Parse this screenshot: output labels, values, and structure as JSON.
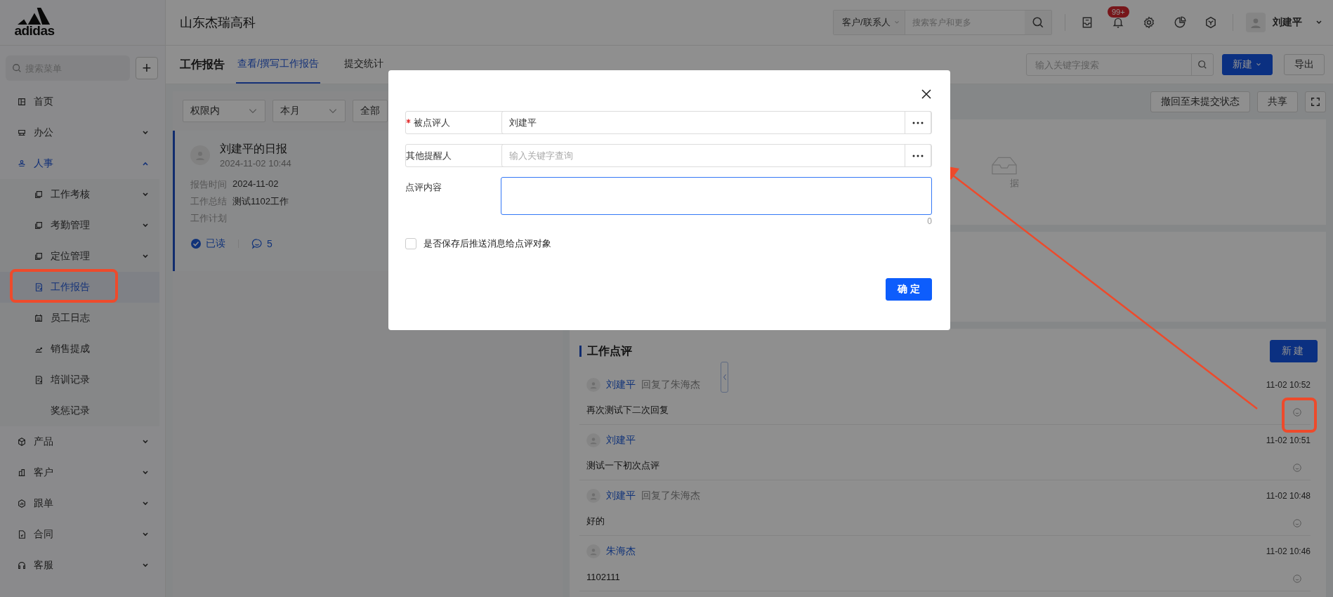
{
  "logo": {
    "text": "adidas"
  },
  "company": "山东杰瑞高科",
  "global_search": {
    "scope": "客户/联系人",
    "placeholder": "搜索客户和更多"
  },
  "notifications": {
    "badge": "99+"
  },
  "user": {
    "name": "刘建平"
  },
  "sidebar": {
    "search_placeholder": "搜索菜单",
    "add_button": "+",
    "items": [
      {
        "label": "首页",
        "selected": false
      },
      {
        "label": "办公",
        "selected": false,
        "expanded": false
      },
      {
        "label": "人事",
        "selected": false,
        "expanded": true,
        "children": [
          {
            "label": "工作考核",
            "selected": false,
            "expanded": false
          },
          {
            "label": "考勤管理",
            "selected": false,
            "expanded": false
          },
          {
            "label": "定位管理",
            "selected": false,
            "expanded": false
          },
          {
            "label": "工作报告",
            "selected": true
          },
          {
            "label": "员工日志",
            "selected": false
          },
          {
            "label": "销售提成",
            "selected": false
          },
          {
            "label": "培训记录",
            "selected": false
          },
          {
            "label": "奖惩记录",
            "selected": false
          }
        ]
      },
      {
        "label": "产品",
        "selected": false,
        "expanded": false
      },
      {
        "label": "客户",
        "selected": false,
        "expanded": false
      },
      {
        "label": "跟单",
        "selected": false,
        "expanded": false
      },
      {
        "label": "合同",
        "selected": false,
        "expanded": false
      },
      {
        "label": "客服",
        "selected": false,
        "expanded": false
      }
    ]
  },
  "page": {
    "title": "工作报告",
    "tabs": [
      {
        "label": "查看/撰写工作报告",
        "selected": true
      },
      {
        "label": "提交统计",
        "selected": false
      }
    ],
    "search_placeholder": "输入关键字搜索",
    "new_button": "新建",
    "export_button": "导出"
  },
  "filters": [
    {
      "label": "权限内",
      "kind": "dropdown"
    },
    {
      "label": "本月",
      "kind": "dropdown"
    },
    {
      "label": "全部",
      "kind": "button"
    }
  ],
  "report_card": {
    "title": "刘建平的日报",
    "datetime": "2024-11-02 10:44",
    "selected": true,
    "fields": [
      {
        "label": "报告时间",
        "value": "2024-11-02"
      },
      {
        "label": "工作总结",
        "value": "测试1102工作"
      },
      {
        "label": "工作计划"
      }
    ],
    "read_status": "已读",
    "comment_count": "5"
  },
  "detail_actions": [
    "撤回至未提交状态",
    "共享"
  ],
  "empty_state": {
    "text": "据"
  },
  "comments_panel": {
    "title": "工作点评",
    "new_button": "新建",
    "comments": [
      {
        "author": "刘建平",
        "reply_to": "回复了朱海杰",
        "time": "11-02 10:52",
        "text": "再次测试下二次回复"
      },
      {
        "author": "刘建平",
        "time": "11-02 10:51",
        "text": "测试一下初次点评"
      },
      {
        "author": "刘建平",
        "reply_to": "回复了朱海杰",
        "time": "11-02 10:48",
        "text": "好的"
      },
      {
        "author": "朱海杰",
        "time": "11-02 10:46",
        "text": "1102111"
      }
    ]
  },
  "dialog": {
    "fields": [
      {
        "label": "被点评人",
        "required": true,
        "kind": "picker",
        "value": "刘建平"
      },
      {
        "label": "其他提醒人",
        "required": false,
        "kind": "picker",
        "placeholder": "输入关键字查询"
      },
      {
        "label": "点评内容",
        "required": false,
        "kind": "textarea",
        "count": "0"
      }
    ],
    "checkbox": {
      "label": "是否保存后推送消息给点评对象",
      "checked": false
    },
    "confirm_button": "确 定"
  }
}
